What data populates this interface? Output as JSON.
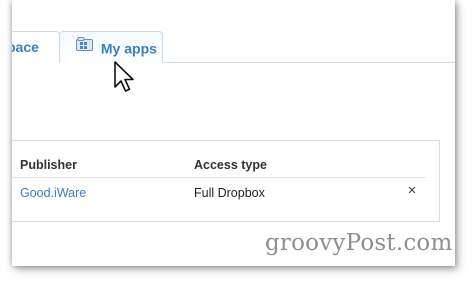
{
  "tabs": [
    {
      "label": "pace",
      "active": false
    },
    {
      "label": "My apps",
      "active": true,
      "icon": "apps-folder-icon"
    }
  ],
  "table": {
    "columns": [
      "Publisher",
      "Access type"
    ],
    "rows": [
      {
        "publisher": "Good.iWare",
        "access_type": "Full Dropbox",
        "remove_label": "×"
      }
    ]
  },
  "watermark": "groovyPost.com",
  "colors": {
    "link": "#3a7fbe",
    "tab_border": "#c9dbe9",
    "watermark": "#8f8f8f"
  }
}
